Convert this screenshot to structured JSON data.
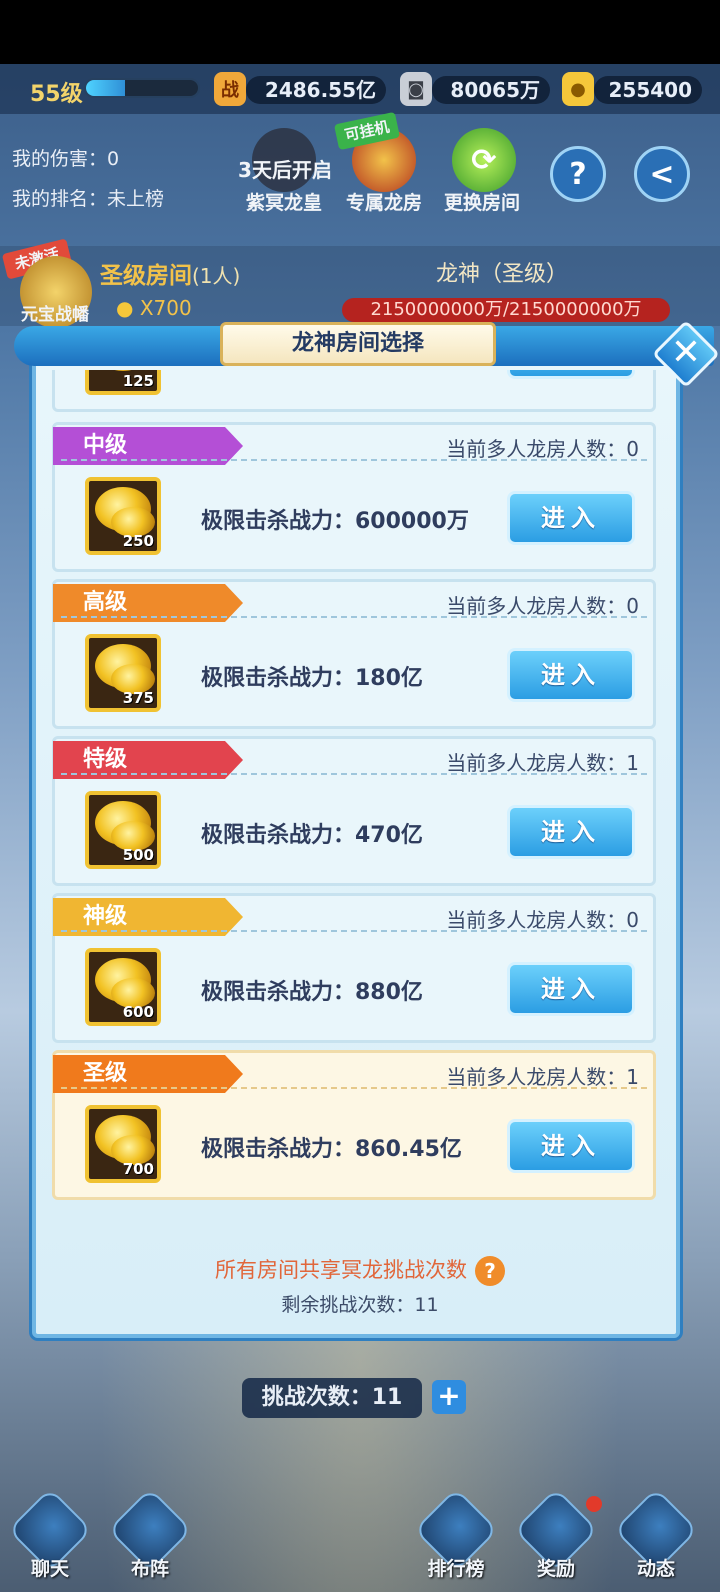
{
  "status_bar": {},
  "player": {
    "level": "55级",
    "level_progress": 0.35,
    "combat_power": "2486.55亿",
    "silver": "80065万",
    "gold": "255400"
  },
  "battle_info": {
    "my_damage": "我的伤害：0",
    "my_rank": "我的排名：未上榜",
    "countdown": "3天后开启",
    "btn_dragon_emperor": "紫冥龙皇",
    "btn_exclusive_room": "专属龙房",
    "btn_exclusive_badge": "可挂机",
    "btn_change_room": "更换房间",
    "help_icon": "?",
    "back_icon": "<"
  },
  "holy_room": {
    "inactive_badge": "未激活",
    "banner_label": "元宝战幡",
    "room_name": "圣级房间",
    "room_people": "(1人)",
    "cost": "X700",
    "boss_name": "龙神（圣级）",
    "boss_hp": "2150000000万/2150000000万"
  },
  "modal": {
    "title": "龙神房间选择",
    "close_icon": "✕",
    "partial_gold": "125",
    "rooms": [
      {
        "tier": "中级",
        "count_label": "当前多人龙房人数：0",
        "gold": "250",
        "power": "极限击杀战力：600000万",
        "enter": "进入",
        "tag_color": "#b44fd6"
      },
      {
        "tier": "高级",
        "count_label": "当前多人龙房人数：0",
        "gold": "375",
        "power": "极限击杀战力：180亿",
        "enter": "进入",
        "tag_color": "#ef8a2a"
      },
      {
        "tier": "特级",
        "count_label": "当前多人龙房人数：1",
        "gold": "500",
        "power": "极限击杀战力：470亿",
        "enter": "进入",
        "tag_color": "#e2444e"
      },
      {
        "tier": "神级",
        "count_label": "当前多人龙房人数：0",
        "gold": "600",
        "power": "极限击杀战力：880亿",
        "enter": "进入",
        "tag_color": "#f0b632"
      },
      {
        "tier": "圣级",
        "count_label": "当前多人龙房人数：1",
        "gold": "700",
        "power": "极限击杀战力：860.45亿",
        "enter": "进入",
        "tag_color": "#f07a1c"
      }
    ],
    "shared_note": "所有房间共享冥龙挑战次数",
    "help_icon": "?",
    "remaining": "剩余挑战次数：11"
  },
  "challenge": {
    "label": "挑战次数：11",
    "plus_icon": "+"
  },
  "bottom_nav": [
    {
      "label": "聊天",
      "icon": "chat-icon"
    },
    {
      "label": "布阵",
      "icon": "formation-icon"
    },
    {
      "label": "排行榜",
      "icon": "ranking-icon"
    },
    {
      "label": "奖励",
      "icon": "reward-icon"
    },
    {
      "label": "动态",
      "icon": "news-icon"
    }
  ]
}
